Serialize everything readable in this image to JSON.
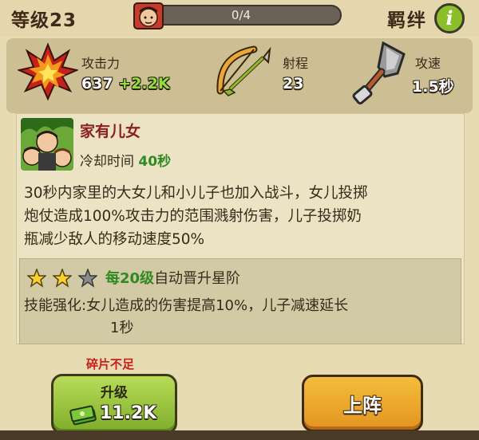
{
  "header": {
    "level_label": "等级23",
    "progress_text": "0/4",
    "progress_fraction": 0,
    "bond_label": "羁绊",
    "info_glyph": "i"
  },
  "stats": [
    {
      "label": "攻击力",
      "value": "637",
      "bonus": "+2.2K",
      "icon": "fire-icon"
    },
    {
      "label": "射程",
      "value": "23",
      "bonus": "",
      "icon": "bow-icon"
    },
    {
      "label": "攻速",
      "value": "1.5秒",
      "bonus": "",
      "icon": "shovel-icon"
    }
  ],
  "skill": {
    "name": "家有儿女",
    "cooldown_label": "冷却时间",
    "cooldown_value": "40秒",
    "description_lines": [
      "30秒内家里的大女儿和小儿子也加入战斗，女儿投掷",
      "炮仗造成100%攻击力的范围溅射伤害，儿子投掷奶",
      "瓶减少敌人的移动速度50%"
    ]
  },
  "upgrade": {
    "stars_filled": 2,
    "stars_total": 3,
    "every_label": "每20级",
    "auto_label": "自动晋升星阶",
    "enhance_line1": "技能强化:女儿造成的伤害提高10%，儿子减速延长",
    "enhance_line2": "1秒"
  },
  "actions": {
    "insufficient_text": "碎片不足",
    "upgrade_label": "升级",
    "upgrade_cost": "11.2K",
    "deploy_label": "上阵"
  },
  "colors": {
    "accent_green": "#2f8a24",
    "skill_name_red": "#8a2020",
    "warning_red": "#c8201a"
  }
}
